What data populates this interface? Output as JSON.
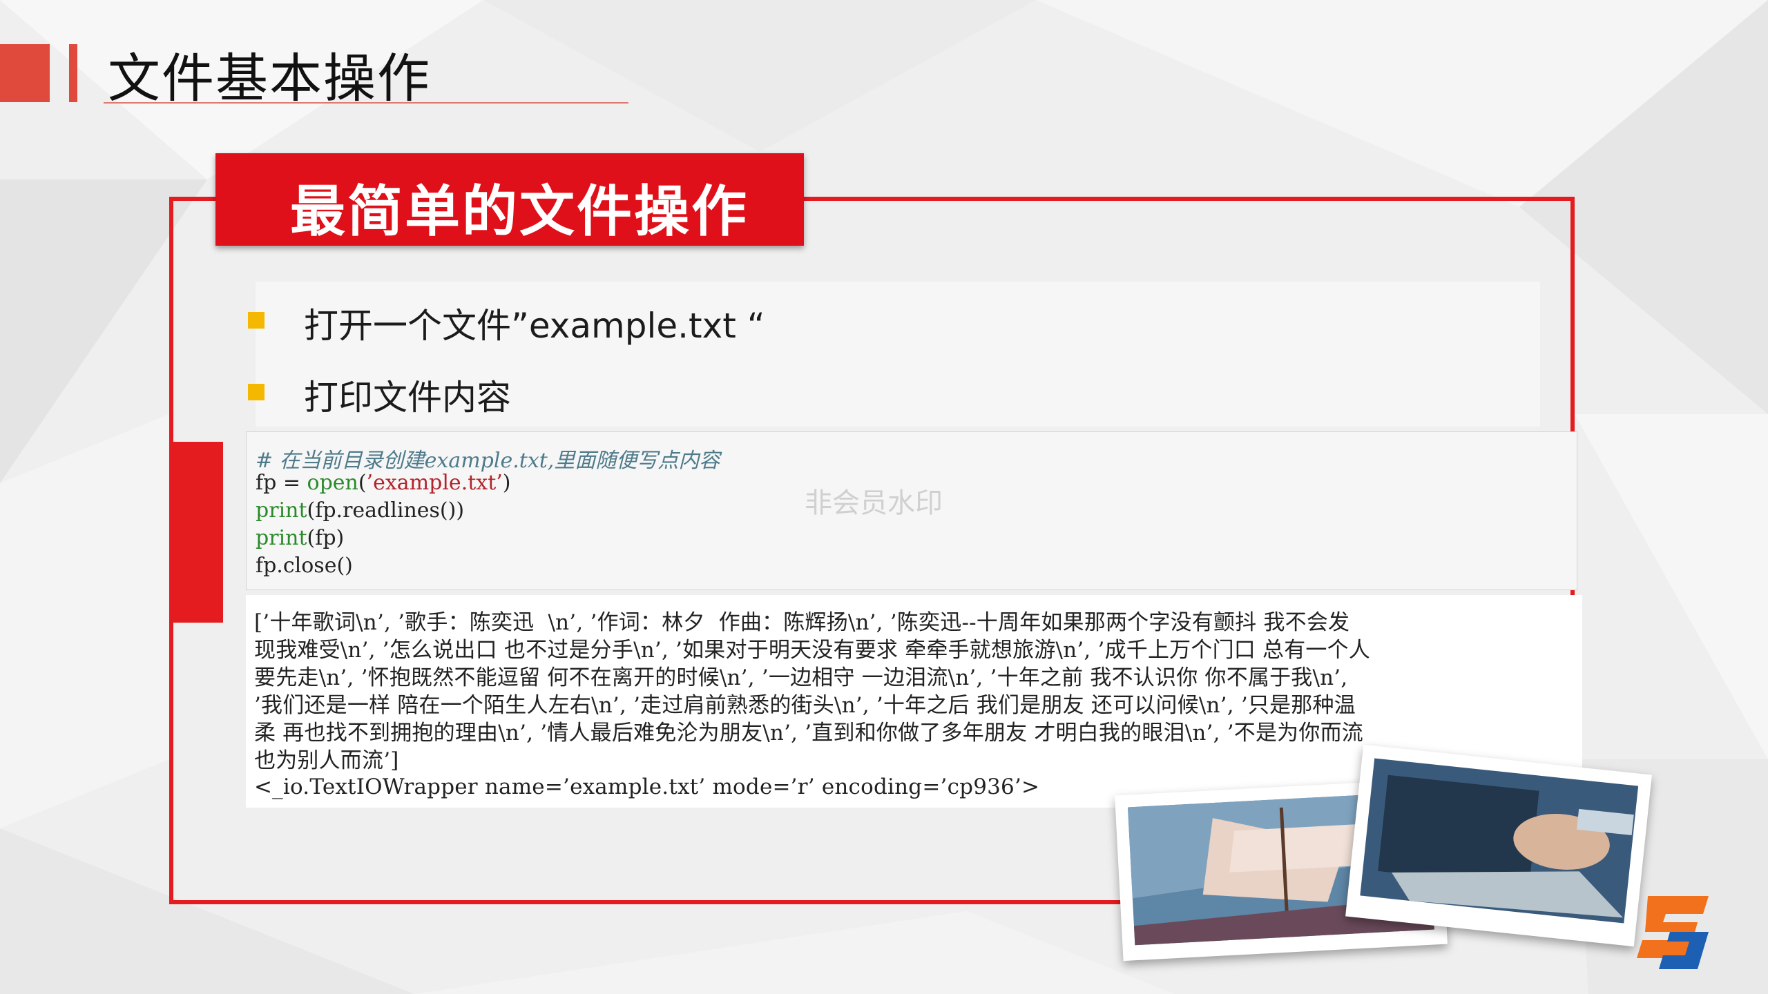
{
  "slide": {
    "title": "文件基本操作",
    "header": "最简单的文件操作",
    "bullets": [
      {
        "label": "打开一个文件”example.txt “"
      },
      {
        "label": "打印文件内容"
      }
    ]
  },
  "code": {
    "comment": "# 在当前目录创建example.txt,里面随便写点内容",
    "line1_a": "fp = ",
    "line1_kw": "open",
    "line1_b": "(",
    "line1_str": "’example.txt’",
    "line1_c": ")",
    "line2_kw": "print",
    "line2_rest": "(fp.readlines())",
    "line3_kw": "print",
    "line3_rest": "(fp)",
    "line4": "fp.close()"
  },
  "watermark": "非会员水印",
  "output": {
    "lines": [
      "[’十年歌词\\n’, ’歌手：陈奕迅  \\n’, ’作词：林夕  作曲：陈辉扬\\n’, ’陈奕迅--十周年如果那两个字没有颤抖 我不会发",
      "现我难受\\n’, ’怎么说出口 也不过是分手\\n’, ’如果对于明天没有要求 牵牵手就想旅游\\n’, ’成千上万个门口 总有一个人",
      "要先走\\n’, ’怀抱既然不能逗留 何不在离开的时候\\n’, ’一边相守 一边泪流\\n’, ’十年之前 我不认识你 你不属于我\\n’,",
      "’我们还是一样 陪在一个陌生人左右\\n’, ’走过肩前熟悉的街头\\n’, ’十年之后 我们是朋友 还可以问候\\n’, ’只是那种温",
      "柔 再也找不到拥抱的理由\\n’, ’情人最后难免沦为朋友\\n’, ’直到和你做了多年朋友 才明白我的眼泪\\n’, ’不是为你而流",
      "也为别人而流’]",
      "<_io.TextIOWrapper name=’example.txt’ mode=’r’ encoding=’cp936’>"
    ]
  },
  "colors": {
    "accent_red": "#e41b1f",
    "bullet_yellow": "#f5b800",
    "keyword_green": "#2a8a2a",
    "string_red": "#b2232b"
  }
}
